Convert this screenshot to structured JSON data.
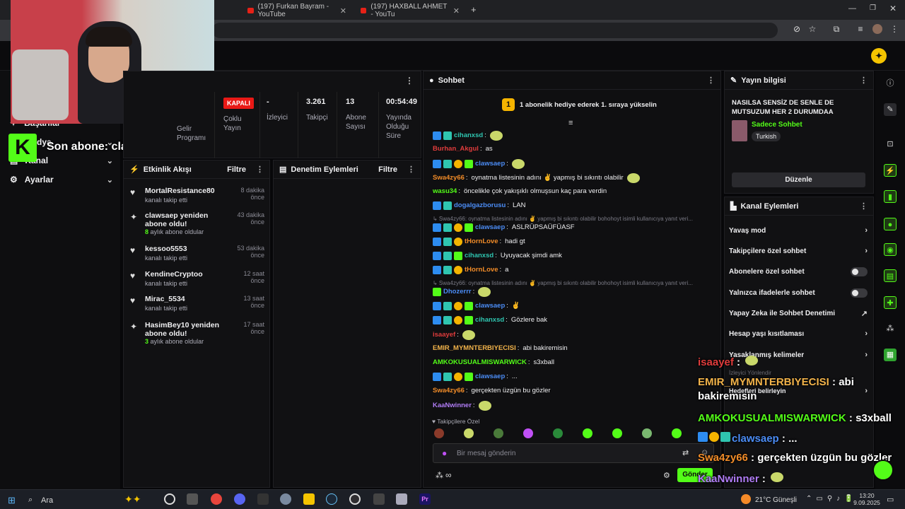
{
  "browser": {
    "tabs": [
      {
        "title": "(197) Furkan Bayram - YouTube"
      },
      {
        "title": "(197) HAXBALL AHMET - YouTu"
      }
    ]
  },
  "sidebar": {
    "items": [
      {
        "label": "Başarılar"
      },
      {
        "label": "Medya"
      },
      {
        "label": "Kanal"
      },
      {
        "label": "Ayarlar"
      }
    ]
  },
  "webcam_overlay": {
    "text": "Son abone: clawsaep"
  },
  "stream_stats": {
    "status": "KAPALI",
    "items": [
      {
        "value": "",
        "label": "Gelir Programı"
      },
      {
        "value": "",
        "label": "Çoklu Yayın"
      },
      {
        "value": "-",
        "label": "İzleyici"
      },
      {
        "value": "3.261",
        "label": "Takipçi"
      },
      {
        "value": "13",
        "label": "Abone Sayısı"
      },
      {
        "value": "00:54:49",
        "label": "Yayında Olduğu Süre"
      }
    ]
  },
  "activity": {
    "title": "Etkinlik Akışı",
    "filter": "Filtre",
    "events": [
      {
        "icon": "heart-icon",
        "name": "MortalResistance80",
        "sub": "kanalı takip etti",
        "time": "8 dakika önce"
      },
      {
        "icon": "sparkle-icon",
        "name": "clawsaep yeniden abone oldu!",
        "sub_count": "8",
        "sub": "aylık abone oldular",
        "time": "43 dakika önce"
      },
      {
        "icon": "heart-icon",
        "name": "kessoo5553",
        "sub": "kanalı takip etti",
        "time": "53 dakika önce"
      },
      {
        "icon": "heart-icon",
        "name": "KendineCryptoo",
        "sub": "kanalı takip etti",
        "time": "12 saat önce"
      },
      {
        "icon": "heart-icon",
        "name": "Mirac_5534",
        "sub": "kanalı takip etti",
        "time": "13 saat önce"
      },
      {
        "icon": "sparkle-icon",
        "name": "HasimBey10 yeniden abone oldu!",
        "sub_count": "3",
        "sub": "aylık abone oldular",
        "time": "17 saat önce"
      }
    ]
  },
  "moderation": {
    "title": "Denetim Eylemleri",
    "filter": "Filtre"
  },
  "chat": {
    "title": "Sohbet",
    "promo": "1 abonelik hediye ederek 1. sıraya yükselin",
    "promo_num": "1",
    "messages": [
      {
        "badges": [
          "b1",
          "b2"
        ],
        "user": "cihanxsd",
        "color": "#2fc5b0",
        "text": "",
        "emote": true
      },
      {
        "badges": [],
        "user": "Burhan_Akgul",
        "color": "#e03c3c",
        "text": "as"
      },
      {
        "badges": [
          "b1",
          "b2",
          "b3",
          "b4"
        ],
        "user": "clawsaep",
        "color": "#4b8cf5",
        "text": "",
        "emote": true
      },
      {
        "badges": [],
        "user": "Swa4zy66",
        "color": "#f28c28",
        "text": "oynatma listesinin adını ✌ yapmış bi sıkıntı olabilir",
        "emote": true
      },
      {
        "badges": [],
        "user": "wasu34",
        "color": "#53fc18",
        "text": "öncelikle çok yakışıklı olmuşsun kaç para verdin"
      },
      {
        "badges": [
          "b1",
          "b2"
        ],
        "user": "dogalgazborusu",
        "color": "#4b8cf5",
        "text": "LAN"
      },
      {
        "reply": "↳ Swa4zy66: oynatma listesinin adını ✌ yapmış bi sıkıntı olabilir bohohoyt isimli kullanıcıya yanıt veri..."
      },
      {
        "badges": [
          "b1",
          "b2",
          "b3",
          "b4"
        ],
        "user": "clawsaep",
        "color": "#4b8cf5",
        "text": "ASLRÜPSAÜFÜASF"
      },
      {
        "badges": [
          "b1",
          "b2",
          "b3"
        ],
        "user": "tHornLove",
        "color": "#f28c28",
        "text": "hadi gt"
      },
      {
        "badges": [
          "b1",
          "b2",
          "b4"
        ],
        "user": "cihanxsd",
        "color": "#2fc5b0",
        "text": "Uyuyacak şimdi amk"
      },
      {
        "badges": [
          "b1",
          "b2",
          "b3"
        ],
        "user": "tHornLove",
        "color": "#f28c28",
        "text": "a"
      },
      {
        "reply": "↳ Swa4zy66: oynatma listesinin adını ✌ yapmış bi sıkıntı olabilir bohohoyt isimli kullanıcıya yanıt veri..."
      },
      {
        "badges": [
          "b4"
        ],
        "user": "Dhozerrr",
        "color": "#4b8cf5",
        "text": "",
        "emote": true
      },
      {
        "badges": [
          "b1",
          "b2",
          "b3",
          "b4"
        ],
        "user": "clawsaep",
        "color": "#4b8cf5",
        "text": "✌"
      },
      {
        "badges": [
          "b1",
          "b2",
          "b3",
          "b4"
        ],
        "user": "cihanxsd",
        "color": "#2fc5b0",
        "text": "Gözlere bak"
      },
      {
        "badges": [],
        "user": "isaayef",
        "color": "#e03c3c",
        "text": "",
        "emote": true
      },
      {
        "badges": [],
        "user": "EMIR_MYMNTERBIYECISI",
        "color": "#f2b34a",
        "text": "abi bakiremisin"
      },
      {
        "badges": [],
        "user": "AMKOKUSUALMISWARWICK",
        "color": "#53fc18",
        "text": "s3xball"
      },
      {
        "badges": [
          "b1",
          "b2",
          "b3",
          "b4"
        ],
        "user": "clawsaep",
        "color": "#4b8cf5",
        "text": "..."
      },
      {
        "badges": [],
        "user": "Swa4zy66",
        "color": "#f28c28",
        "text": "gerçekten üzgün bu gözler"
      },
      {
        "badges": [],
        "user": "KaaNwinner",
        "color": "#b07cf5",
        "text": "",
        "emote": true
      }
    ],
    "followers_only": "Takipçilere Özel",
    "input_placeholder": "Bir mesaj gönderin",
    "send": "Gönder",
    "emote_count": "∞"
  },
  "stream_info": {
    "title": "Yayın bilgisi",
    "stream_title": "NASILSA SENSİZ DE SENLE DE MUTSUZUM HER 2 DURUMDAA",
    "category": "Sadece Sohbet",
    "tag": "Turkish",
    "edit": "Düzenle"
  },
  "channel_actions": {
    "title": "Kanal Eylemleri",
    "items": [
      {
        "label": "Yavaş mod",
        "kind": "chev"
      },
      {
        "label": "Takipçilere özel sohbet",
        "kind": "chev"
      },
      {
        "label": "Abonelere özel sohbet",
        "kind": "toggle"
      },
      {
        "label": "Yalnızca ifadelerle sohbet",
        "kind": "toggle"
      },
      {
        "label": "Yapay Zeka ile Sohbet Denetimi",
        "kind": "ext"
      },
      {
        "label": "Hesap yaşı kısıtlaması",
        "kind": "chev"
      },
      {
        "label": "Yasaklanmış kelimeler",
        "kind": "chev"
      }
    ],
    "viewer_guided": "İzleyici Yönlendir",
    "goals": "Hedefleri belirleyin"
  },
  "overlay_chat": [
    {
      "user": "isaayef",
      "color": "#e03c3c",
      "text": "",
      "emote": true
    },
    {
      "user": "EMIR_MYMNTERBIYECISI",
      "color": "#f2b34a",
      "text": "abi bakiremisin"
    },
    {
      "user": "AMKOKUSUALMISWARWICK",
      "color": "#53fc18",
      "text": "s3xball"
    },
    {
      "user": "clawsaep",
      "color": "#4b8cf5",
      "text": "..."
    },
    {
      "user": "Swa4zy66",
      "color": "#f28c28",
      "text": "gerçekten üzgün bu gözler"
    },
    {
      "user": "KaaNwinner",
      "color": "#b07cf5",
      "text": "",
      "emote": true
    }
  ],
  "taskbar": {
    "search": "Ara",
    "weather": "21°C  Güneşli",
    "time": "13:20",
    "date": "9.09.2025"
  },
  "colors": {
    "kick_green": "#53fc18",
    "bg": "#0e0e10"
  }
}
